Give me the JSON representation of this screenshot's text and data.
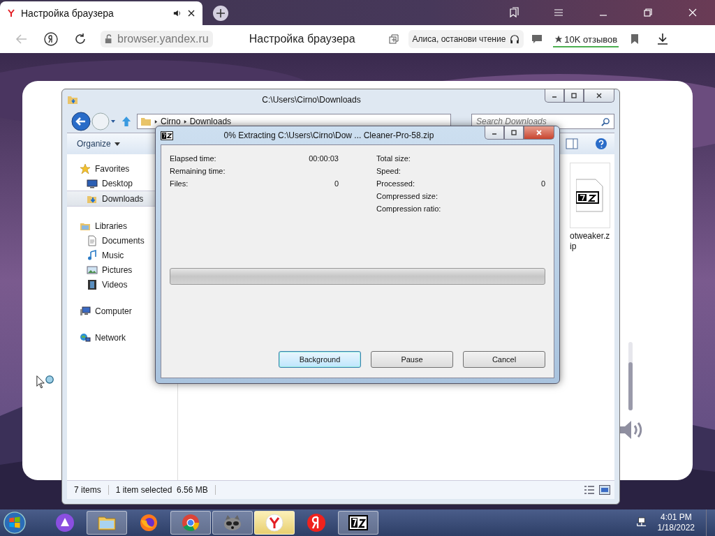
{
  "browser": {
    "tab": {
      "title": "Настройка браузера"
    },
    "address": "browser.yandex.ru",
    "page_title": "Настройка браузера",
    "alice_button": "Алиса, останови чтение",
    "reviews": "10K отзывов"
  },
  "explorer": {
    "title": "C:\\Users\\Cirno\\Downloads",
    "breadcrumb": [
      "Cirno",
      "Downloads"
    ],
    "search": {
      "placeholder": "Search Downloads"
    },
    "organize": "Organize",
    "nav": [
      {
        "label": "Favorites",
        "kind": "favorites",
        "selected": false,
        "children": [
          {
            "label": "Desktop",
            "kind": "desktop",
            "selected": false
          },
          {
            "label": "Downloads",
            "kind": "downloads",
            "selected": true
          }
        ]
      },
      {
        "label": "Libraries",
        "kind": "libraries",
        "selected": false,
        "children": [
          {
            "label": "Documents",
            "kind": "documents",
            "selected": false
          },
          {
            "label": "Music",
            "kind": "music",
            "selected": false
          },
          {
            "label": "Pictures",
            "kind": "pictures",
            "selected": false
          },
          {
            "label": "Videos",
            "kind": "videos",
            "selected": false
          }
        ]
      },
      {
        "label": "Computer",
        "kind": "computer",
        "selected": false
      },
      {
        "label": "Network",
        "kind": "network",
        "selected": false
      }
    ],
    "file": {
      "name": "otweaker.zip"
    },
    "status": {
      "count": "7 items",
      "selection": "1 item selected",
      "size": "6.56 MB"
    }
  },
  "dialog": {
    "title": "0% Extracting C:\\Users\\Cirno\\Dow ... Cleaner-Pro-58.zip",
    "left": [
      {
        "label": "Elapsed time:",
        "value": "00:00:03"
      },
      {
        "label": "Remaining time:"
      },
      {
        "label": "Files:",
        "value": "0"
      }
    ],
    "right": [
      {
        "label": "Total size:"
      },
      {
        "label": "Speed:"
      },
      {
        "label": "Processed:",
        "value": "0"
      },
      {
        "label": "Compressed size:"
      },
      {
        "label": "Compression ratio:"
      }
    ],
    "progress": {
      "level": 0
    },
    "buttons": [
      {
        "label": "Background",
        "focused": true
      },
      {
        "label": "Pause",
        "focused": false
      },
      {
        "label": "Cancel",
        "focused": false
      }
    ]
  },
  "volume": {
    "level": 0.7
  },
  "taskbar": {
    "apps": [
      {
        "kind": "alice",
        "open": false,
        "active": false
      },
      {
        "kind": "explorer",
        "open": true,
        "active": false
      },
      {
        "kind": "firefox",
        "open": false,
        "active": false
      },
      {
        "kind": "chrome",
        "open": true,
        "active": false
      },
      {
        "kind": "raccoon",
        "open": true,
        "active": false
      },
      {
        "kind": "yabrowser",
        "open": true,
        "active": true
      },
      {
        "kind": "yandex",
        "open": false,
        "active": false
      },
      {
        "kind": "sevenzip",
        "open": true,
        "active": false
      }
    ],
    "clock": {
      "time": "4:01 PM",
      "date": "1/18/2022"
    }
  }
}
